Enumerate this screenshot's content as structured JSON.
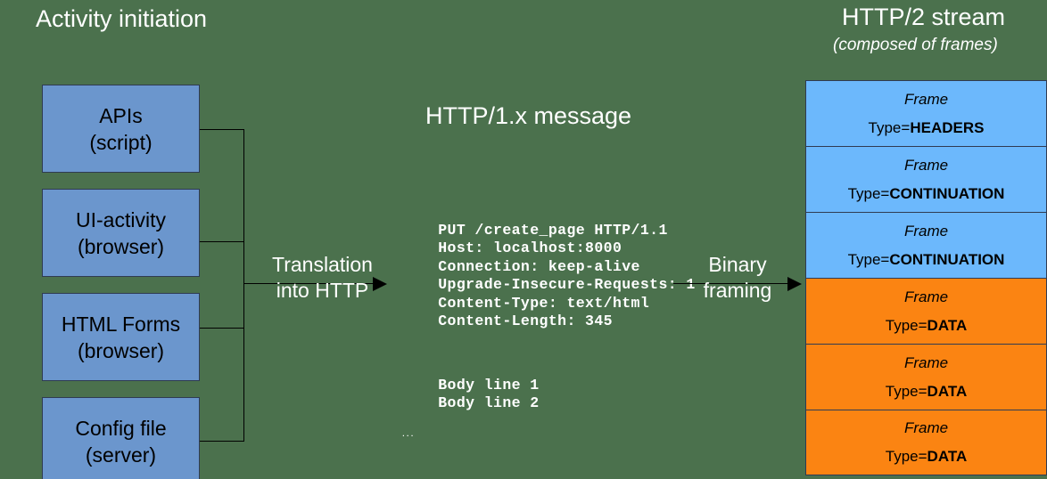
{
  "colors": {
    "background": "#4b714d",
    "source_box_fill": "#6b96cd",
    "frame_blue": "#6cb8fc",
    "frame_orange": "#fb8412",
    "line": "#000000",
    "title_text": "#ffffff"
  },
  "headings": {
    "left_title": "Activity initiation",
    "center_title": "HTTP/1.x message",
    "right_title": "HTTP/2 stream",
    "right_subtitle": "(composed of frames)"
  },
  "sources": [
    {
      "line1": "APIs",
      "line2": "(script)"
    },
    {
      "line1": "UI-activity",
      "line2": "(browser)"
    },
    {
      "line1": "HTML Forms",
      "line2": "(browser)"
    },
    {
      "line1": "Config file",
      "line2": "(server)"
    }
  ],
  "arrows": [
    {
      "name": "translation",
      "line1": "Translation",
      "line2": "into HTTP"
    },
    {
      "name": "binary",
      "line1": "Binary",
      "line2": "framing"
    }
  ],
  "http_message": {
    "lines": [
      "PUT /create_page HTTP/1.1",
      "Host: localhost:8000",
      "Connection: keep-alive",
      "Upgrade-Insecure-Requests: 1",
      "Content-Type: text/html",
      "Content-Length: 345"
    ],
    "body_lines": [
      "Body line 1",
      "Body line 2"
    ],
    "ellipsis": "..."
  },
  "frames": [
    {
      "name_label": "Frame",
      "type_prefix": "Type=",
      "type": "HEADERS",
      "color": "blue"
    },
    {
      "name_label": "Frame",
      "type_prefix": "Type=",
      "type": "CONTINUATION",
      "color": "blue"
    },
    {
      "name_label": "Frame",
      "type_prefix": "Type=",
      "type": "CONTINUATION",
      "color": "blue"
    },
    {
      "name_label": "Frame",
      "type_prefix": "Type=",
      "type": "DATA",
      "color": "orange"
    },
    {
      "name_label": "Frame",
      "type_prefix": "Type=",
      "type": "DATA",
      "color": "orange"
    },
    {
      "name_label": "Frame",
      "type_prefix": "Type=",
      "type": "DATA",
      "color": "orange"
    }
  ]
}
